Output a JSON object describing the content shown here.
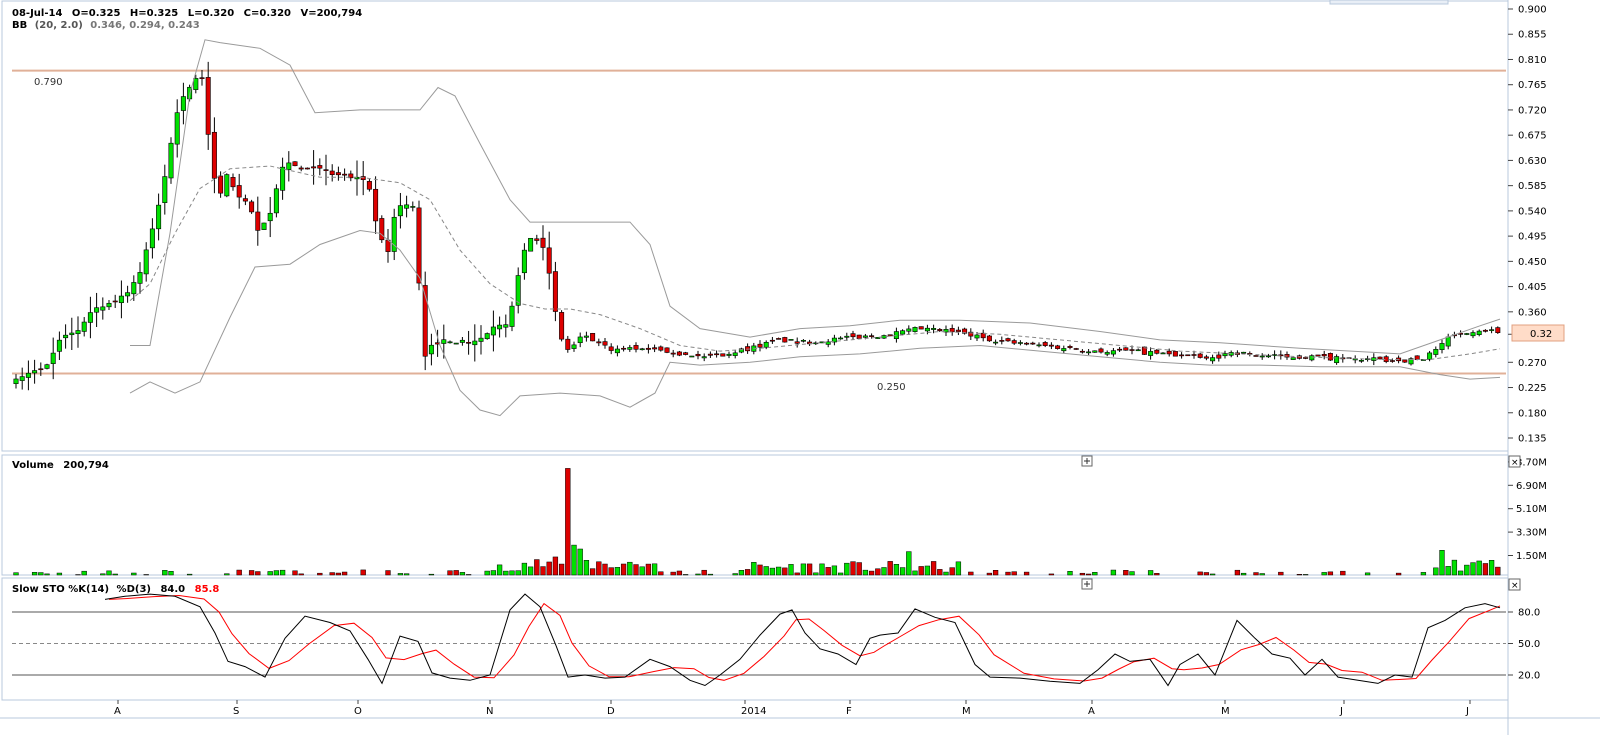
{
  "price_panel": {
    "ohlc_date": "08-Jul-14",
    "ohlc_open": "O=0.325",
    "ohlc_high": "H=0.325",
    "ohlc_low": "L=0.320",
    "ohlc_close": "C=0.320",
    "ohlc_volume": "V=200,794",
    "bb_label": "BB",
    "bb_params": "(20, 2.0)",
    "bb_values": "0.346, 0.294, 0.243",
    "resistance_label": "0.790",
    "support_label": "0.250",
    "current_price_tag": "0.32"
  },
  "volume_panel": {
    "title": "Volume",
    "value": "200,794"
  },
  "stoch_panel": {
    "title": "Slow STO %K",
    "k_period": "(14)",
    "d_label": "%D",
    "d_period": "(3)",
    "k_value": "84.0",
    "d_value": "85.8"
  },
  "x_axis_labels": [
    "A",
    "S",
    "O",
    "N",
    "D",
    "2014",
    "F",
    "M",
    "A",
    "M",
    "J",
    "J"
  ],
  "colors": {
    "up": "#00e000",
    "down": "#dd0000",
    "band": "#9a9a9a",
    "level_line": "#e0b098",
    "stoch_k": "#000000",
    "stoch_d": "#ff0000",
    "price_tag_bg": "#ffdcc8"
  },
  "chart_data": [
    {
      "type": "candlestick",
      "title": "",
      "ylim": [
        0.12,
        0.9
      ],
      "y_ticks": [
        "0.900",
        "0.855",
        "0.810",
        "0.765",
        "0.720",
        "0.675",
        "0.630",
        "0.585",
        "0.540",
        "0.495",
        "0.450",
        "0.405",
        "0.360",
        "0.32",
        "0.270",
        "0.225",
        "0.180",
        "0.135"
      ],
      "horizontal_levels": [
        0.79,
        0.25
      ],
      "candles_approx": [
        {
          "x": "A",
          "close": 0.24
        },
        {
          "x": "A",
          "close": 0.27
        },
        {
          "x": "A",
          "close": 0.33
        },
        {
          "x": "A",
          "close": 0.38
        },
        {
          "x": "A",
          "close": 0.45
        },
        {
          "x": "A",
          "close": 0.58
        },
        {
          "x": "A",
          "close": 0.76
        },
        {
          "x": "A",
          "close": 0.8
        },
        {
          "x": "A",
          "close": 0.66
        },
        {
          "x": "S",
          "close": 0.55
        },
        {
          "x": "S",
          "close": 0.48
        },
        {
          "x": "S",
          "close": 0.64
        },
        {
          "x": "S",
          "close": 0.61
        },
        {
          "x": "S",
          "close": 0.6
        },
        {
          "x": "O",
          "close": 0.48
        },
        {
          "x": "O",
          "close": 0.57
        },
        {
          "x": "O",
          "close": 0.5
        },
        {
          "x": "O",
          "close": 0.26
        },
        {
          "x": "O",
          "close": 0.3
        },
        {
          "x": "N",
          "close": 0.32
        },
        {
          "x": "N",
          "close": 0.51
        },
        {
          "x": "N",
          "close": 0.48
        },
        {
          "x": "N",
          "close": 0.36
        },
        {
          "x": "N",
          "close": 0.27
        },
        {
          "x": "D",
          "close": 0.3
        },
        {
          "x": "D",
          "close": 0.29
        },
        {
          "x": "D",
          "close": 0.28
        },
        {
          "x": "2014",
          "close": 0.3
        },
        {
          "x": "2014",
          "close": 0.32
        },
        {
          "x": "F",
          "close": 0.32
        },
        {
          "x": "F",
          "close": 0.33
        },
        {
          "x": "M",
          "close": 0.32
        },
        {
          "x": "M",
          "close": 0.3
        },
        {
          "x": "A",
          "close": 0.29
        },
        {
          "x": "A",
          "close": 0.28
        },
        {
          "x": "M",
          "close": 0.29
        },
        {
          "x": "M",
          "close": 0.28
        },
        {
          "x": "J",
          "close": 0.27
        },
        {
          "x": "J",
          "close": 0.28
        },
        {
          "x": "J",
          "close": 0.32
        }
      ],
      "bollinger": {
        "period": 20,
        "stddev": 2.0,
        "upper_last": 0.346,
        "middle_last": 0.294,
        "lower_last": 0.243
      }
    },
    {
      "type": "bar",
      "title": "Volume",
      "y_ticks": [
        "8.70M",
        "6.90M",
        "5.10M",
        "3.30M",
        "1.50M"
      ],
      "ylim": [
        0,
        9000000
      ],
      "notable_bars": [
        {
          "x": "N",
          "value": 8200000
        },
        {
          "x": "N",
          "value": 2300000
        },
        {
          "x": "J",
          "value": 1900000
        }
      ]
    },
    {
      "type": "line",
      "title": "Slow STO %K(14) %D(3)",
      "ylim": [
        0,
        100
      ],
      "y_ticks": [
        "80.0",
        "50.0",
        "20.0"
      ],
      "reference_lines": [
        80,
        50,
        20
      ],
      "series": [
        {
          "name": "%K",
          "last": 84.0
        },
        {
          "name": "%D",
          "last": 85.8
        }
      ]
    }
  ]
}
